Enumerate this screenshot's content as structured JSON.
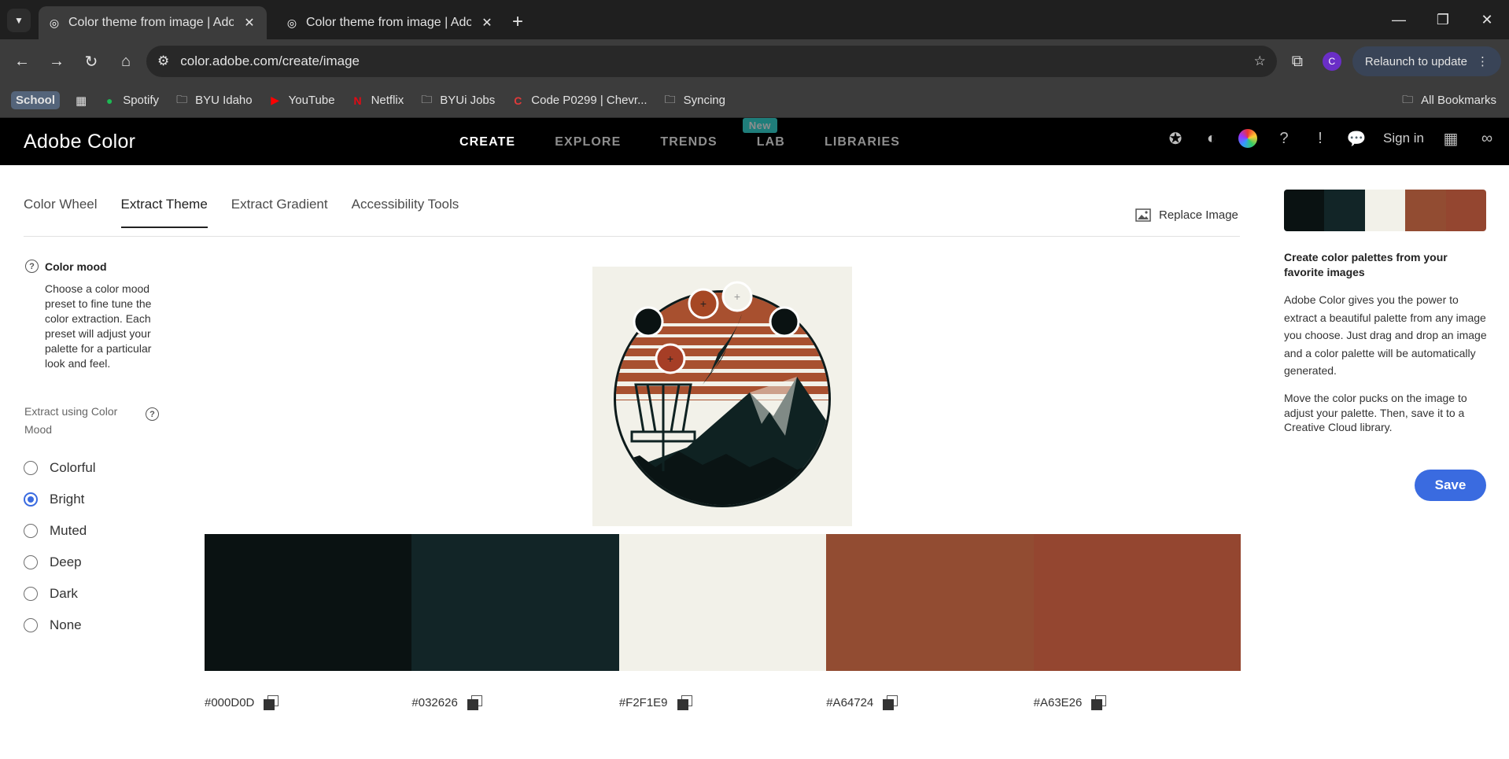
{
  "browser": {
    "tabs": [
      {
        "title": "Color theme from image | Adob",
        "active": true
      },
      {
        "title": "Color theme from image | Adob",
        "active": false
      }
    ],
    "url": "color.adobe.com/create/image",
    "relaunch_label": "Relaunch to update",
    "profile_initial": "C",
    "bookmarks": [
      "School",
      "Spotify",
      "BYU Idaho",
      "YouTube",
      "Netflix",
      "BYUi Jobs",
      "Code P0299 | Chevr...",
      "Syncing"
    ],
    "all_bookmarks": "All Bookmarks"
  },
  "app": {
    "brand": "Adobe Color",
    "nav": [
      "CREATE",
      "EXPLORE",
      "TRENDS",
      "LAB",
      "LIBRARIES"
    ],
    "new_badge": "New",
    "sign_in": "Sign in"
  },
  "subtabs": [
    "Color Wheel",
    "Extract Theme",
    "Extract Gradient",
    "Accessibility Tools"
  ],
  "replace_image": "Replace Image",
  "mood": {
    "title": "Color mood",
    "description": "Choose a color mood preset to fine tune the color extraction. Each preset will adjust your palette for a particular look and feel.",
    "extract_label": "Extract using Color Mood",
    "options": [
      "Colorful",
      "Bright",
      "Muted",
      "Deep",
      "Dark",
      "None"
    ],
    "selected": "Bright"
  },
  "palette": {
    "colors": [
      "#0A1212",
      "#122527",
      "#F2F1E9",
      "#924C32",
      "#944630"
    ],
    "hex_labels": [
      "#000D0D",
      "#032626",
      "#F2F1E9",
      "#A64724",
      "#A63E26"
    ]
  },
  "right_panel": {
    "title": "Create color palettes from your favorite images",
    "paragraph1": "Adobe Color gives you the power to extract a beautiful palette from any image you choose. Just drag and drop an image and a color palette will be automatically generated.",
    "paragraph2": "Move the color pucks on the image to adjust your palette. Then, save it to a Creative Cloud library.",
    "save_label": "Save"
  },
  "colors": {
    "accent": "#3A6BE0",
    "dark_bg": "#1F1F1F"
  }
}
